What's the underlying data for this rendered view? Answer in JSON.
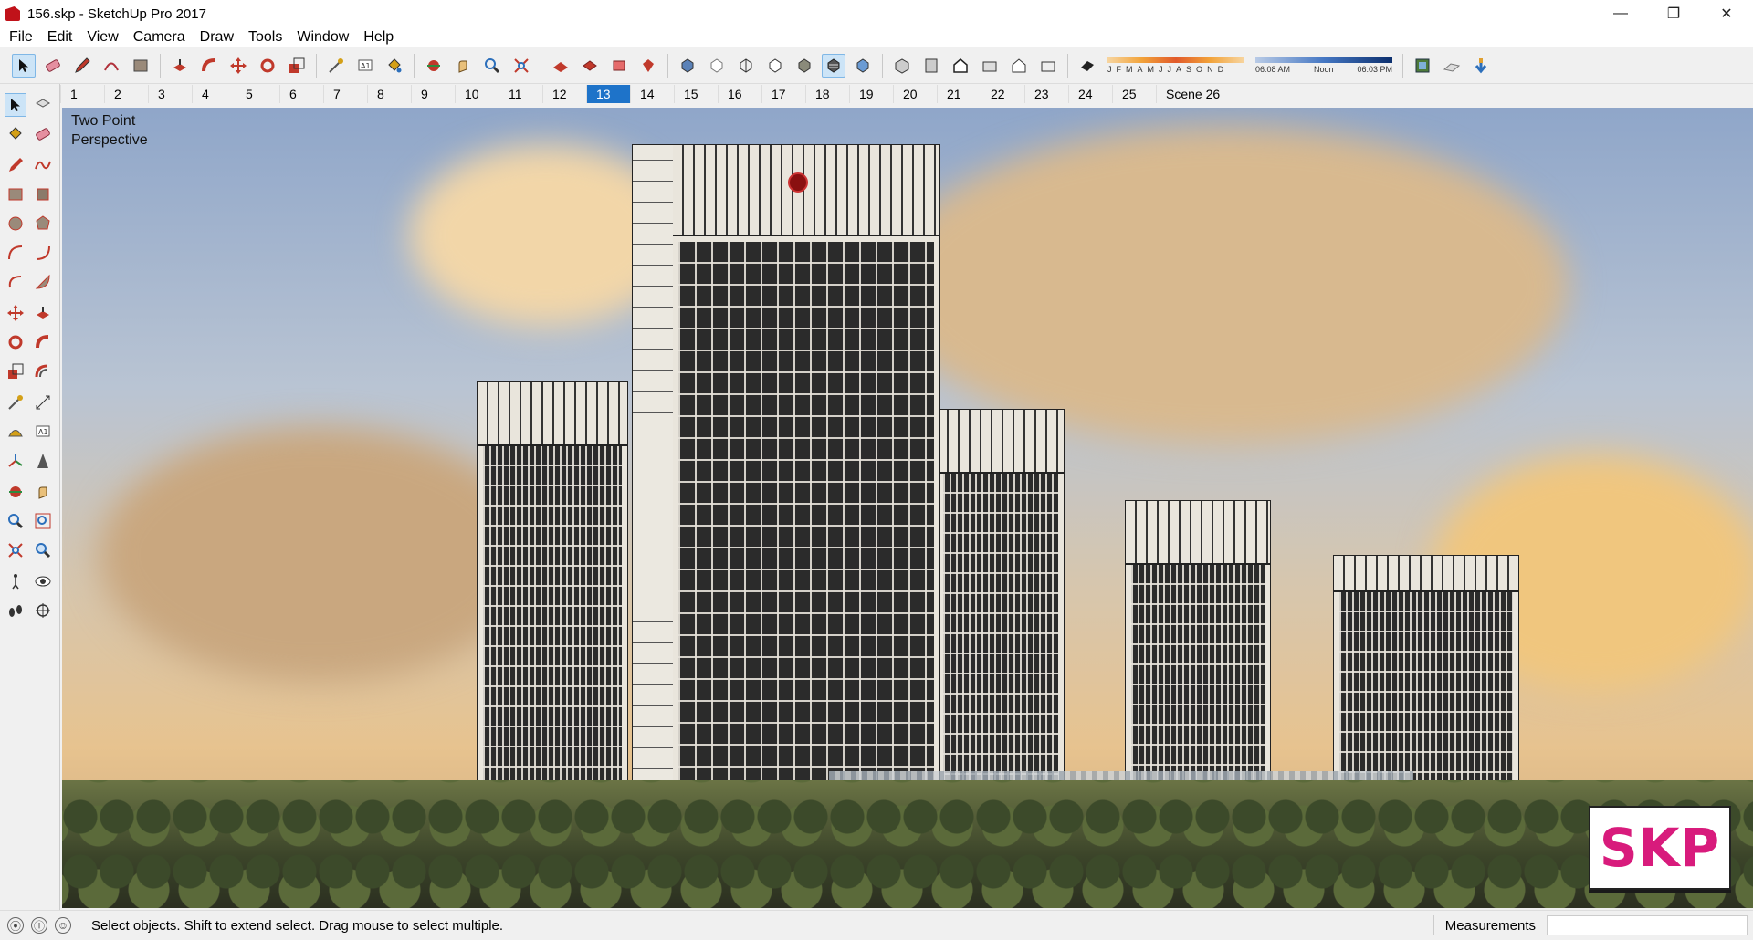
{
  "window": {
    "title": "156.skp - SketchUp Pro 2017",
    "controls": [
      "—",
      "❐",
      "✕"
    ]
  },
  "menu": [
    "File",
    "Edit",
    "View",
    "Camera",
    "Draw",
    "Tools",
    "Window",
    "Help"
  ],
  "shadows": {
    "months": [
      "J",
      "F",
      "M",
      "A",
      "M",
      "J",
      "J",
      "A",
      "S",
      "O",
      "N",
      "D"
    ],
    "time_start": "06:08 AM",
    "time_mid": "Noon",
    "time_end": "06:03 PM"
  },
  "scenes": {
    "tabs": [
      "1",
      "2",
      "3",
      "4",
      "5",
      "6",
      "7",
      "8",
      "9",
      "10",
      "11",
      "12",
      "13",
      "14",
      "15",
      "16",
      "17",
      "18",
      "19",
      "20",
      "21",
      "22",
      "23",
      "24",
      "25",
      "Scene 26"
    ],
    "active": "13"
  },
  "viewport": {
    "camera_label": "Two Point\nPerspective",
    "badge": "SKP"
  },
  "status": {
    "message": "Select objects. Shift to extend select. Drag mouse to select multiple.",
    "measurements_label": "Measurements",
    "measurements_value": ""
  },
  "colors": {
    "accent": "#1e73c9",
    "badge": "#d81b7c"
  }
}
